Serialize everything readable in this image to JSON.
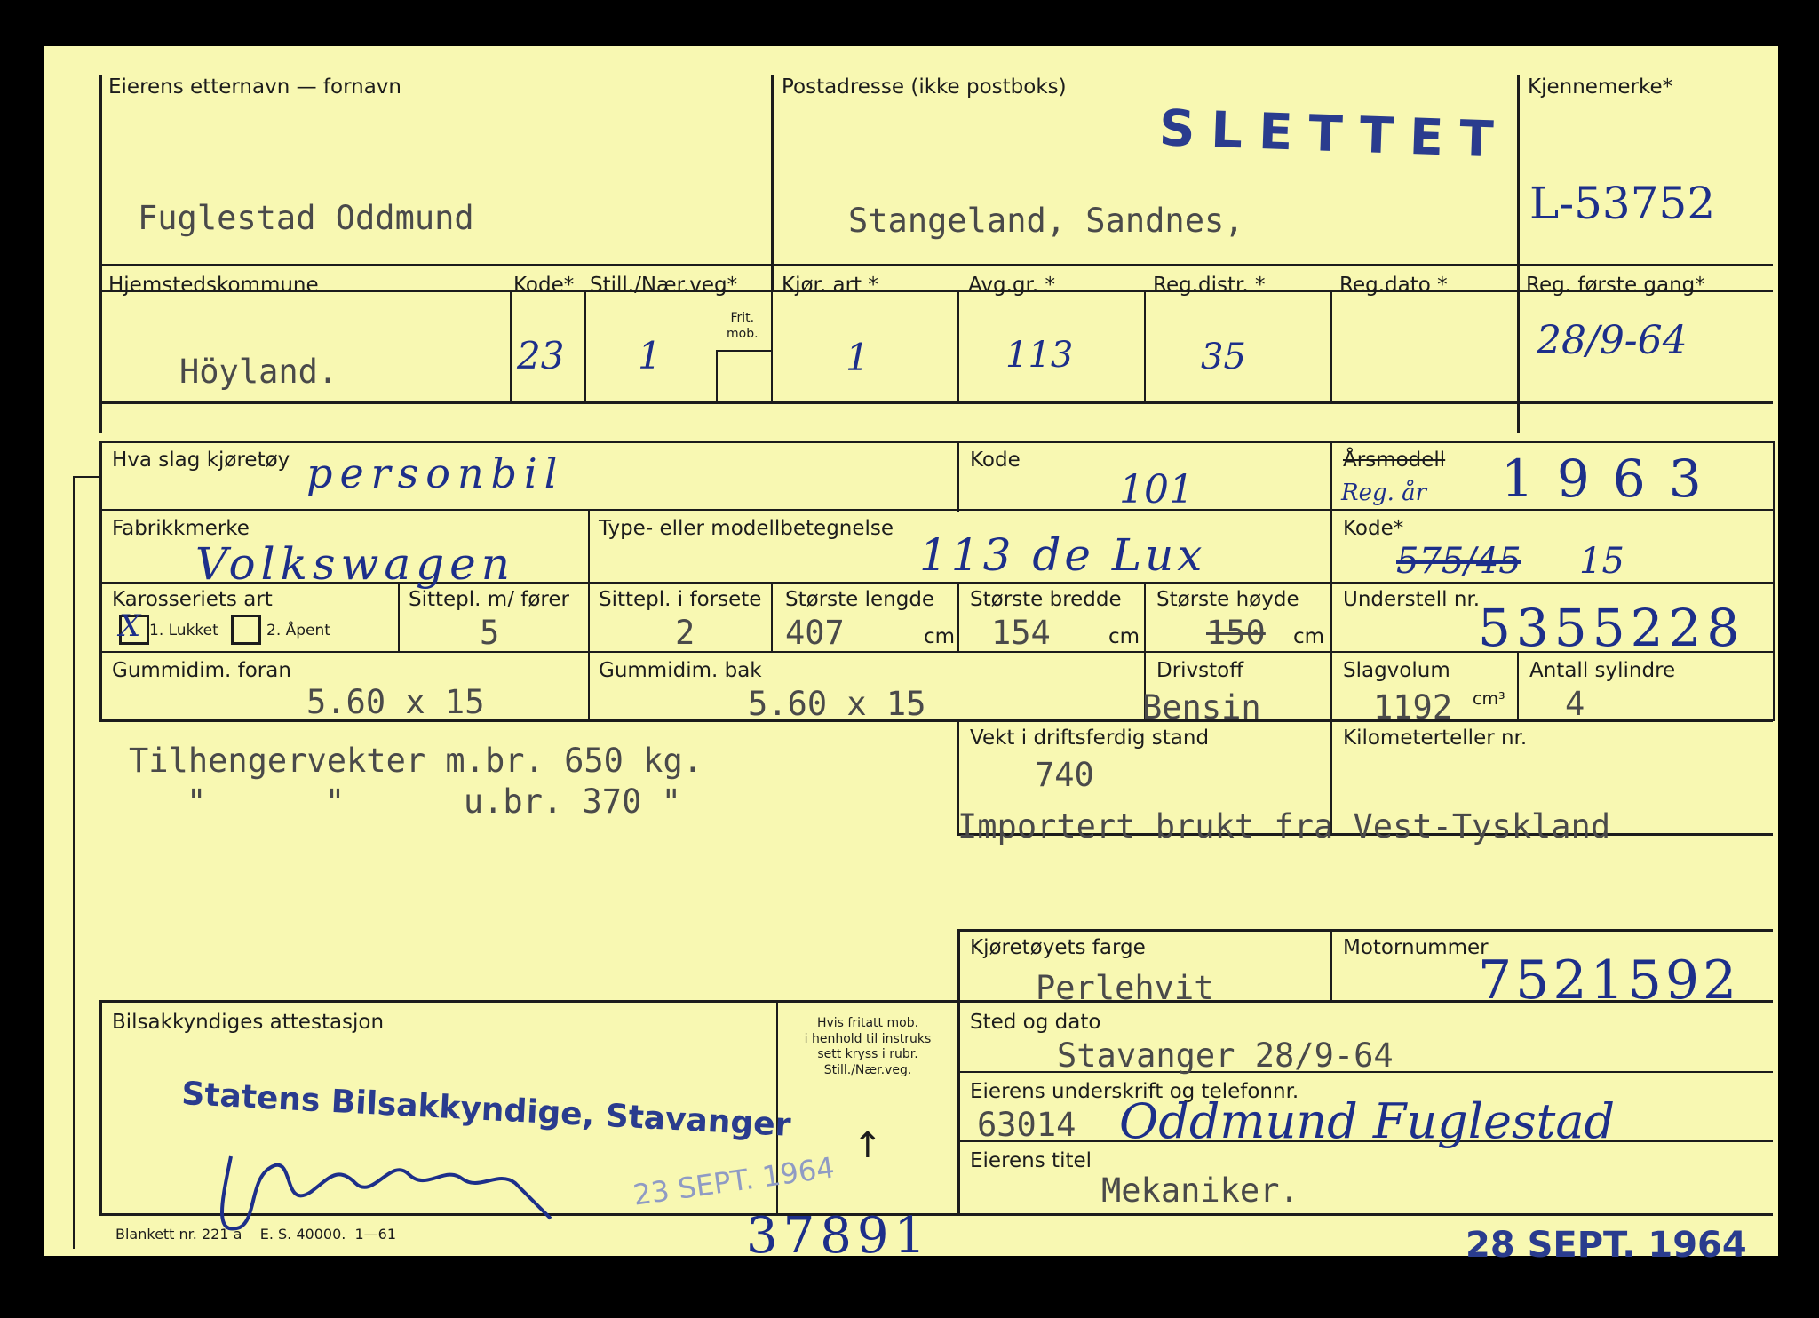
{
  "labels": {
    "owner_name": "Eierens etternavn — fornavn",
    "postal_address": "Postadresse (ikke postboks)",
    "reg_mark": "Kjennemerke*",
    "home_municipality": "Hjemstedskommune",
    "code": "Kode*",
    "stillnar": "Still./Nær.veg*",
    "frit_mob": "Frit.\nmob.",
    "drive_type": "Kjør. art *",
    "fee_group": "Avg.gr. *",
    "reg_district": "Reg.distr. *",
    "reg_date": "Reg.dato *",
    "reg_first": "Reg. første gang*",
    "vehicle_kind": "Hva slag kjøretøy",
    "kind_code": "Kode",
    "model_year": "Årsmodell",
    "make": "Fabrikkmerke",
    "type_model": "Type- eller modellbetegnelse",
    "make_code": "Kode*",
    "body_type": "Karosseriets art",
    "closed": "1. Lukket",
    "open": "2. Åpent",
    "seats_driver": "Sittepl. m/ fører",
    "seats_front": "Sittepl. i forsete",
    "max_length": "Største lengde",
    "max_width": "Største bredde",
    "max_height": "Største høyde",
    "cm": "cm",
    "chassis_no": "Understell nr.",
    "tire_front": "Gummidim. foran",
    "tire_rear": "Gummidim. bak",
    "fuel": "Drivstoff",
    "displacement": "Slagvolum",
    "cm3": "cm³",
    "cylinders": "Antall sylindre",
    "curb_weight": "Vekt i driftsferdig stand",
    "odometer": "Kilometerteller nr.",
    "color": "Kjøretøyets farge",
    "engine_no": "Motornummer",
    "inspector": "Bilsakkyndiges attestasjon",
    "exempt_note": "Hvis fritatt mob.\ni henhold til instruks\nsett kryss i rubr.\nStill./Nær.veg.",
    "place_date": "Sted og dato",
    "owner_sig": "Eierens underskrift og telefonnr.",
    "owner_title": "Eierens titel",
    "form_no": "Blankett nr. 221 a    E. S. 40000.  1—61"
  },
  "values": {
    "owner_name": "Fuglestad Oddmund",
    "postal_address": "Stangeland, Sandnes,",
    "status_stamp": "SLETTET",
    "reg_mark": "L-53752",
    "home_municipality": "Höyland.",
    "code": "23",
    "stillnar": "1",
    "drive_type": "1",
    "fee_group": "113",
    "reg_district": "35",
    "reg_first": "28/9-64",
    "vehicle_kind": "personbil",
    "kind_code": "101",
    "reg_year_label": "Reg. år",
    "model_year": "1963",
    "make": "Volkswagen",
    "type_model": "113 de Lux",
    "make_code_old": "575/45",
    "make_code_new": "15",
    "body_mark": "X",
    "seats_driver": "5",
    "seats_front": "2",
    "max_length": "407",
    "max_width": "154",
    "max_height": "150",
    "chassis_no": "5355228",
    "tire_front": "5.60 x 15",
    "tire_rear": "5.60 x 15",
    "fuel": "Bensin",
    "displacement": "1192",
    "cylinders": "4",
    "trailer_line1": "Tilhengervekter m.br. 650 kg.",
    "trailer_line2": "\"      \"      u.br. 370 \"",
    "curb_weight": "740",
    "import_note": "Importert brukt fra Vest-Tyskland",
    "color": "Perlehvit",
    "engine_no": "7521592",
    "inspector_stamp": "Statens Bilsakkyndige, Stavanger",
    "stamp_date_1": "23 SEPT. 1964",
    "arrow": "↑",
    "place_date": "Stavanger 28/9-64",
    "phone": "63014",
    "owner_signature": "Oddmund Fuglestad",
    "owner_title": "Mekaniker.",
    "ref_number": "37891",
    "stamp_date_2": "28 SEPT. 1964"
  }
}
